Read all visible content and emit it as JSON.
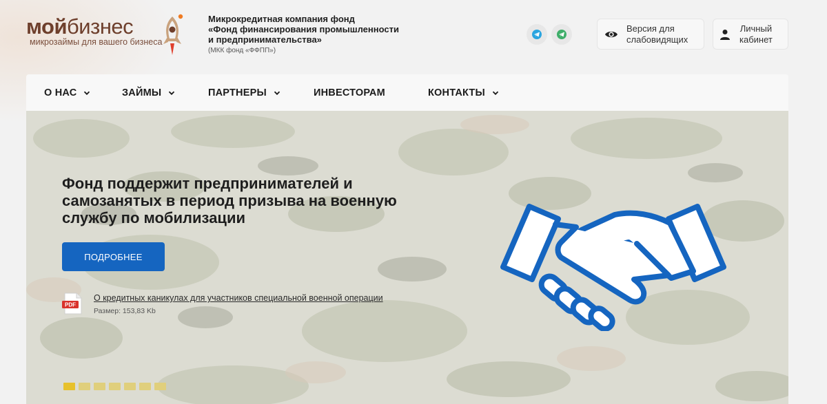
{
  "logo": {
    "word_bold": "мой",
    "word_regular": "бизнес",
    "tagline": "микрозаймы для вашего бизнеса"
  },
  "org": {
    "line1": "Микрокредитная компания фонд",
    "line2": "«Фонд финансирования промышленности",
    "line3": "и предпринимательства»",
    "short": "(МКК фонд «ФФПП»)"
  },
  "social": [
    {
      "icon": "telegram-icon"
    },
    {
      "icon": "telegram-icon"
    }
  ],
  "tools": {
    "vision_line1": "Версия для",
    "vision_line2": "слабовидящих",
    "cabinet_line1": "Личный",
    "cabinet_line2": "кабинет"
  },
  "nav": {
    "items": [
      {
        "label": "О НАС",
        "has_dropdown": true
      },
      {
        "label": "ЗАЙМЫ",
        "has_dropdown": true
      },
      {
        "label": "ПАРТНЕРЫ",
        "has_dropdown": true
      },
      {
        "label": "ИНВЕСТОРАМ",
        "has_dropdown": false
      },
      {
        "label": "КОНТАКТЫ",
        "has_dropdown": true
      }
    ]
  },
  "hero": {
    "title": "Фонд поддержит предпринимателей и самозанятых в период призыва на военную службу по мобилизации",
    "button": "ПОДРОБНЕЕ",
    "pdf_label": "PDF",
    "doc_link": "О кредитных каникулах для участников специальной военной операции",
    "doc_size": "Размер: 153,83 Kb",
    "slides_count": 7,
    "active_slide": 0
  },
  "colors": {
    "brand_brown": "#6e3f2c",
    "accent_blue": "#1565c0",
    "slider_dot": "#e0cf7c"
  }
}
